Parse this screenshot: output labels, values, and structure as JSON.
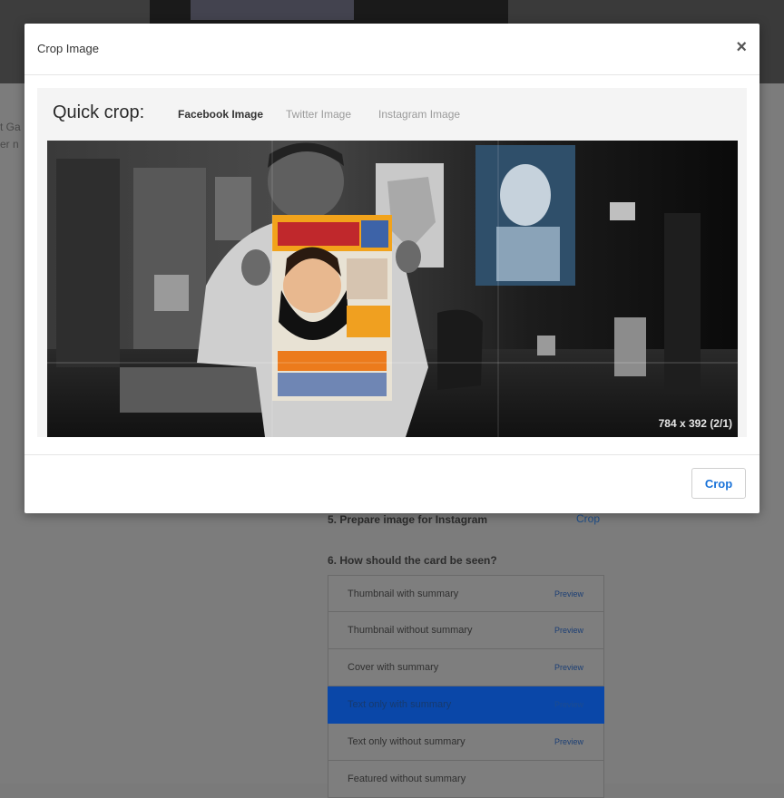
{
  "modal": {
    "title": "Crop Image",
    "close_symbol": "×",
    "quick_crop_label": "Quick crop:",
    "tabs": [
      {
        "label": "Facebook Image",
        "active": true
      },
      {
        "label": "Twitter Image",
        "active": false
      },
      {
        "label": "Instagram Image",
        "active": false
      }
    ],
    "crop_dimensions": "784 x 392 (2/1)",
    "crop_button_label": "Crop"
  },
  "background": {
    "side_text": [
      "t Ga",
      "er n"
    ],
    "steps": [
      {
        "label": "5. Prepare image for Instagram"
      },
      {
        "label": "6. How should the card be seen?"
      }
    ],
    "instagram_crop_link": "Crop",
    "card_options": [
      {
        "label": "Thumbnail with summary",
        "preview": "Preview",
        "active": false
      },
      {
        "label": "Thumbnail without summary",
        "preview": "Preview",
        "active": false
      },
      {
        "label": "Cover with summary",
        "preview": "Preview",
        "active": false
      },
      {
        "label": "Text only with summary",
        "preview": "Preview",
        "active": true
      },
      {
        "label": "Text only without summary",
        "preview": "Preview",
        "active": false
      },
      {
        "label": "Featured without summary",
        "preview": "",
        "active": false
      }
    ]
  },
  "colors": {
    "accent": "#1a73d9",
    "active_option": "#0a47a8",
    "overlay": "#7c7c7c"
  }
}
